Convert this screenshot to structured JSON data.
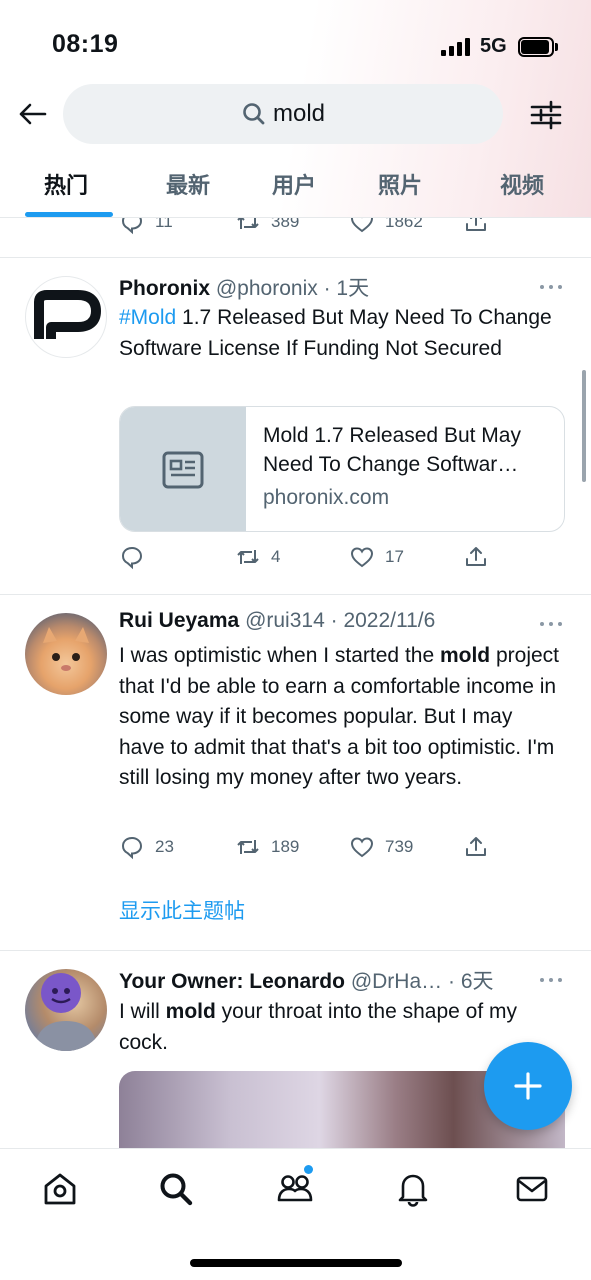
{
  "status_bar": {
    "time": "08:19",
    "network": "5G"
  },
  "search": {
    "query": "mold"
  },
  "tabs": [
    {
      "label": "热门",
      "active": true
    },
    {
      "label": "最新",
      "active": false
    },
    {
      "label": "用户",
      "active": false
    },
    {
      "label": "照片",
      "active": false
    },
    {
      "label": "视频",
      "active": false
    }
  ],
  "tweets": [
    {
      "id": "partial",
      "replies": "11",
      "retweets": "389",
      "likes": "1862"
    },
    {
      "id": "phoronix",
      "name": "Phoronix",
      "handle": "@phoronix",
      "time": "1天",
      "hashtag": "#Mold",
      "text": " 1.7 Released But May Need To Change Software License If Funding Not Secured",
      "card": {
        "title": "Mold 1.7 Released But May Need To Change Softwar…",
        "domain": "phoronix.com"
      },
      "replies": "",
      "retweets": "4",
      "likes": "17"
    },
    {
      "id": "rui",
      "name": "Rui Ueyama",
      "handle": "@rui314",
      "time": "2022/11/6",
      "text_before": "I was optimistic when I started the ",
      "keyword": "mold",
      "text_after": " project that I'd be able to earn a comfortable income in some way if it becomes popular. But I may have to admit that that's a bit too optimistic. I'm still losing my money after two years.",
      "replies": "23",
      "retweets": "189",
      "likes": "739",
      "thread_link": "显示此主题帖"
    },
    {
      "id": "leonardo",
      "name": "Your Owner: Leonardo",
      "handle": "@DrHa…",
      "time": "6天",
      "text_before": "I will ",
      "keyword": "mold",
      "text_after": " your throat into the shape of my cock."
    }
  ],
  "colors": {
    "accent": "#1d9bf0",
    "secondary_text": "#536471"
  },
  "icons": [
    "back-arrow-icon",
    "search-icon",
    "filter-icon",
    "reply-icon",
    "retweet-icon",
    "like-icon",
    "share-icon",
    "more-icon",
    "article-icon",
    "compose-plus-icon",
    "home-icon",
    "explore-icon",
    "communities-icon",
    "notifications-icon",
    "messages-icon"
  ]
}
